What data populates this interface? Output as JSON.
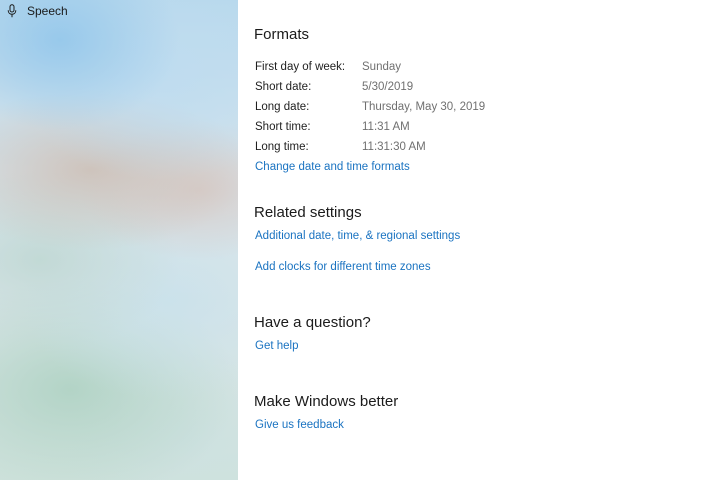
{
  "sidebar": {
    "item": {
      "label": "Speech",
      "icon": "microphone-icon"
    }
  },
  "formats": {
    "title": "Formats",
    "rows": [
      {
        "label": "First day of week:",
        "value": "Sunday"
      },
      {
        "label": "Short date:",
        "value": "5/30/2019"
      },
      {
        "label": "Long date:",
        "value": "Thursday, May 30, 2019"
      },
      {
        "label": "Short time:",
        "value": "11:31 AM"
      },
      {
        "label": "Long time:",
        "value": "11:31:30 AM"
      }
    ],
    "change_link": "Change date and time formats"
  },
  "related": {
    "title": "Related settings",
    "links": [
      "Additional date, time, & regional settings",
      "Add clocks for different time zones"
    ]
  },
  "question": {
    "title": "Have a question?",
    "link": "Get help"
  },
  "better": {
    "title": "Make Windows better",
    "link": "Give us feedback"
  },
  "colors": {
    "link": "#1a73c1",
    "value_text": "#707070",
    "label_text": "#1f1f1f"
  }
}
